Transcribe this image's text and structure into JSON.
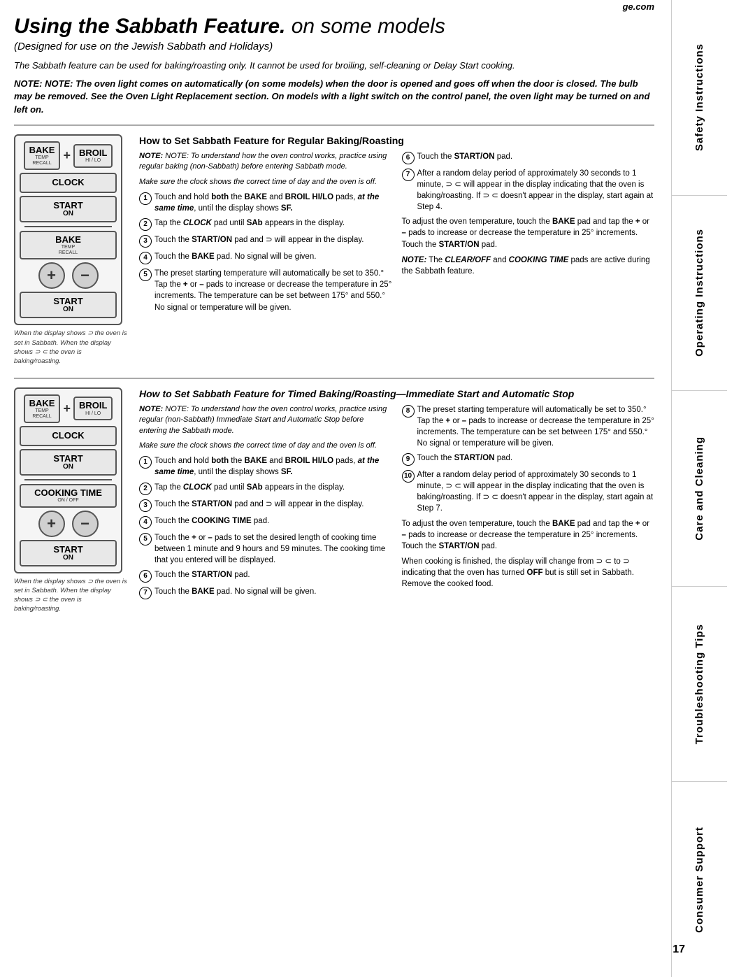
{
  "sidebar": {
    "sections": [
      {
        "label": "Safety Instructions"
      },
      {
        "label": "Operating Instructions"
      },
      {
        "label": "Care and Cleaning"
      },
      {
        "label": "Troubleshooting Tips"
      },
      {
        "label": "Consumer Support"
      }
    ]
  },
  "header": {
    "title_part1": "Using the Sabbath Feature.",
    "title_part2": " on some models",
    "subtitle": "(Designed for use on the Jewish Sabbath and Holidays)",
    "ge_com": "ge.com"
  },
  "intro": {
    "note1": "The Sabbath feature can be used for baking/roasting only. It cannot be used for broiling, self-cleaning or Delay Start cooking.",
    "note2": "NOTE: The oven light comes on automatically (on some models) when the door is opened and goes off when the door is closed. The bulb may be removed. See the Oven Light Replacement section. On models with a light switch on the control panel, the oven light may be turned on and left on."
  },
  "section1": {
    "heading": "How to Set Sabbath Feature for Regular Baking/Roasting",
    "panel_caption": "When the display shows ⊃ the oven is set in Sabbath. When the display shows ⊃ ⊂ the oven is baking/roasting.",
    "buttons": {
      "bake": "BAKE",
      "bake_sub1": "TEMP",
      "bake_sub2": "RECALL",
      "broil": "BROIL",
      "broil_sub": "HI / LO",
      "clock": "CLOCK",
      "start": "START",
      "on": "ON"
    },
    "note_italic": "NOTE: To understand how the oven control works, practice using regular baking (non-Sabbath) before entering Sabbath mode.",
    "note_italic2": "Make sure the clock shows the correct time of day and the oven is off.",
    "steps_left": [
      {
        "num": "1",
        "text": "Touch and hold both the BAKE and BROIL HI/LO pads, at the same time, until the display shows SF."
      },
      {
        "num": "2",
        "text": "Tap the CLOCK pad until SAb appears in the display."
      },
      {
        "num": "3",
        "text": "Touch the START/ON pad and ⊃ will appear in the display."
      },
      {
        "num": "4",
        "text": "Touch the BAKE pad. No signal will be given."
      },
      {
        "num": "5",
        "text": "The preset starting temperature will automatically be set to 350.° Tap the + or – pads to increase or decrease the temperature in 25° increments. The temperature can be set between 175° and 550.° No signal or temperature will be given."
      }
    ],
    "steps_right": [
      {
        "num": "6",
        "text": "Touch the START/ON pad."
      },
      {
        "num": "7",
        "text": "After a random delay period of approximately 30 seconds to 1 minute, ⊃ ⊂ will appear in the display indicating that the oven is baking/roasting. If ⊃ ⊂ doesn't appear in the display, start again at Step 4."
      }
    ],
    "right_para1": "To adjust the oven temperature, touch the BAKE pad and tap the + or – pads to increase or decrease the temperature in 25° increments. Touch the START/ON pad.",
    "right_note": "NOTE: The CLEAR/OFF and COOKING TIME pads are active during the Sabbath feature."
  },
  "section2": {
    "heading": "How to Set Sabbath Feature for Timed Baking/Roasting—Immediate Start and Automatic Stop",
    "panel_caption": "When the display shows ⊃ the oven is set in Sabbath. When the display shows ⊃ ⊂ the oven is baking/roasting.",
    "buttons": {
      "bake": "BAKE",
      "bake_sub1": "TEMP",
      "bake_sub2": "RECALL",
      "broil": "BROIL",
      "broil_sub": "HI / LO",
      "clock": "CLOCK",
      "start": "START",
      "on": "ON",
      "cooking_time": "COOKING TIME",
      "on_off": "ON / OFF"
    },
    "note_italic": "NOTE: To understand how the oven control works, practice using regular (non-Sabbath) Immediate Start and Automatic Stop before entering the Sabbath mode.",
    "note_italic2": "Make sure the clock shows the correct time of day and the oven is off.",
    "steps_left": [
      {
        "num": "1",
        "text": "Touch and hold both the BAKE and BROIL HI/LO pads, at the same time, until the display shows SF."
      },
      {
        "num": "2",
        "text": "Tap the CLOCK pad until SAb appears in the display."
      },
      {
        "num": "3",
        "text": "Touch the START/ON pad and ⊃ will appear in the display."
      },
      {
        "num": "4",
        "text": "Touch the COOKING TIME pad."
      },
      {
        "num": "5",
        "text": "Touch the + or – pads to set the desired length of cooking time between 1 minute and 9 hours and 59 minutes. The cooking time that you entered will be displayed."
      },
      {
        "num": "6",
        "text": "Touch the START/ON pad."
      },
      {
        "num": "7",
        "text": "Touch the BAKE pad. No signal will be given."
      }
    ],
    "steps_right": [
      {
        "num": "8",
        "text": "The preset starting temperature will automatically be set to 350.° Tap the + or – pads to increase or decrease the temperature in 25° increments. The temperature can be set between 175° and 550.° No signal or temperature will be given."
      },
      {
        "num": "9",
        "text": "Touch the START/ON pad."
      },
      {
        "num": "10",
        "text": "After a random delay period of approximately 30 seconds to 1 minute, ⊃ ⊂ will appear in the display indicating that the oven is baking/roasting. If ⊃ ⊂ doesn't appear in the display, start again at Step 7."
      }
    ],
    "right_para1": "To adjust the oven temperature, touch the BAKE pad and tap the + or – pads to increase or decrease the temperature in 25° increments. Touch the START/ON pad.",
    "right_para2": "When cooking is finished, the display will change from ⊃ ⊂ to ⊃ indicating that the oven has turned OFF but is still set in Sabbath. Remove the cooked food."
  },
  "page_number": "17"
}
